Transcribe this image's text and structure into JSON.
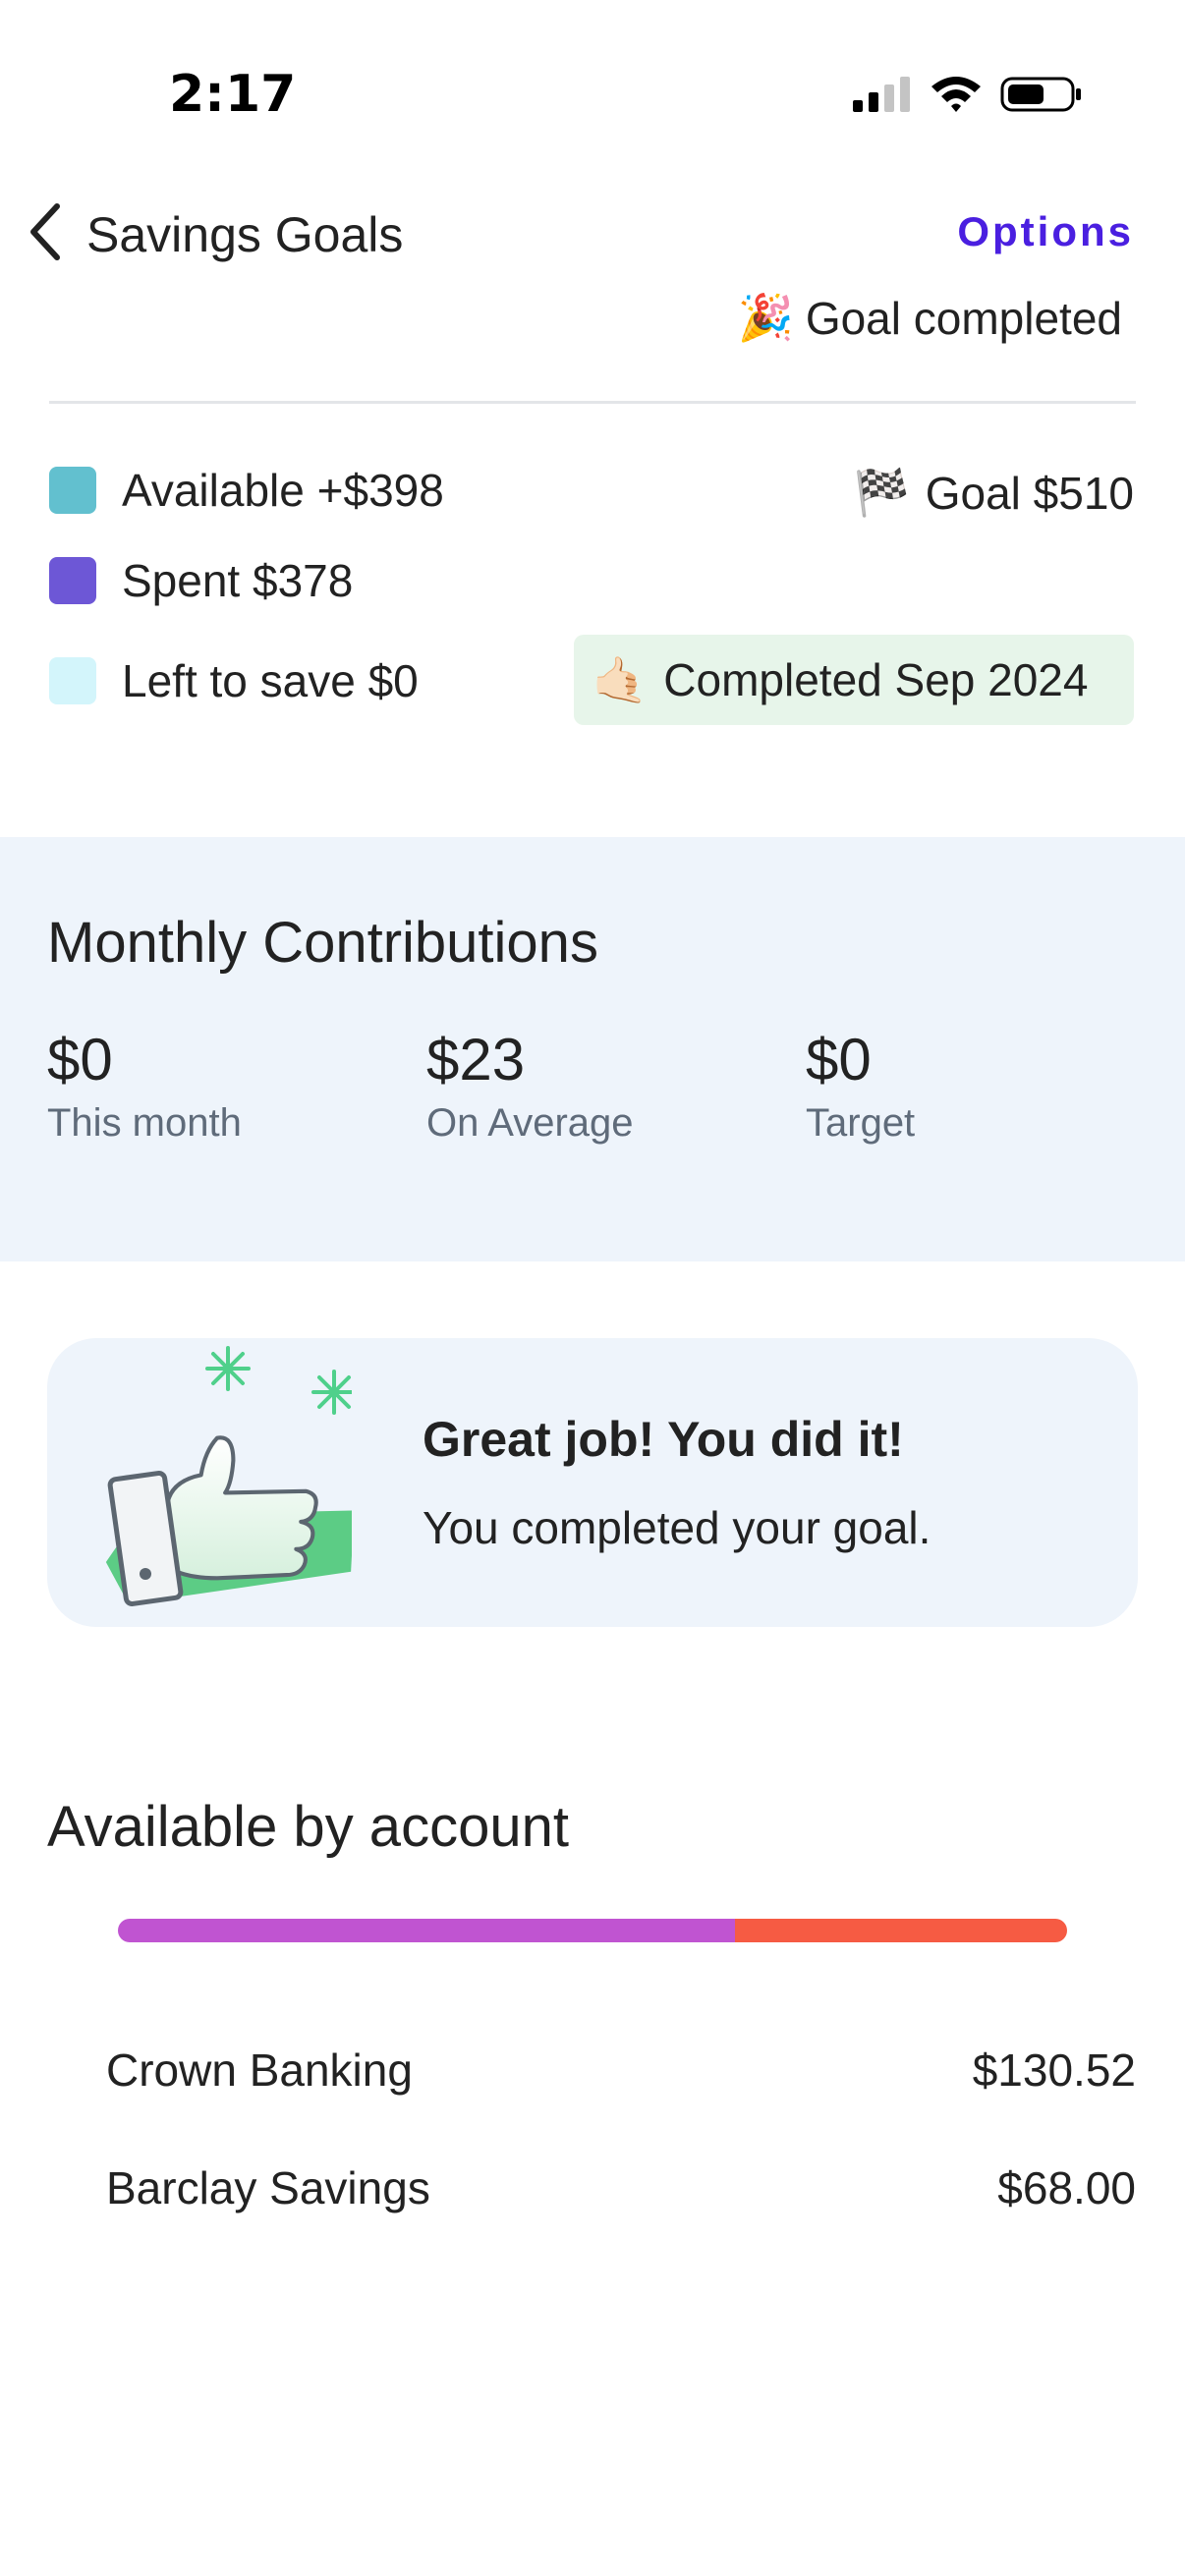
{
  "status_bar": {
    "time": "2:17",
    "icons": [
      "signal-icon",
      "wifi-icon",
      "battery-icon"
    ]
  },
  "nav": {
    "back_label": "Savings Goals",
    "options_label": "Options",
    "accent_color": "#4a1fe0"
  },
  "goal_status": {
    "emoji": "🎉",
    "text": "Goal completed"
  },
  "legend": [
    {
      "label": "Available +$398",
      "color": "#62c0cf"
    },
    {
      "label": "Spent $378",
      "color": "#6d57d6"
    },
    {
      "label": "Left to save $0",
      "color": "#d3f5fb"
    }
  ],
  "goal": {
    "emoji": "🏁",
    "text": "Goal $510"
  },
  "completed_pill": {
    "emoji": "🤙🏻",
    "text": "Completed Sep 2024",
    "bg_color": "#e7f5ea"
  },
  "contributions": {
    "title": "Monthly Contributions",
    "stats": [
      {
        "value": "$0",
        "label": "This month"
      },
      {
        "value": "$23",
        "label": "On Average"
      },
      {
        "value": "$0",
        "label": "Target"
      }
    ]
  },
  "congrats": {
    "title": "Great job! You did it!",
    "subtitle": "You completed your goal."
  },
  "accounts": {
    "title": "Available by account",
    "bar": [
      {
        "share": 0.65,
        "color": "#c054d1"
      },
      {
        "share": 0.35,
        "color": "#f65b43"
      }
    ],
    "items": [
      {
        "name": "Crown Banking",
        "amount": "$130.52"
      },
      {
        "name": "Barclay Savings",
        "amount": "$68.00"
      }
    ]
  }
}
